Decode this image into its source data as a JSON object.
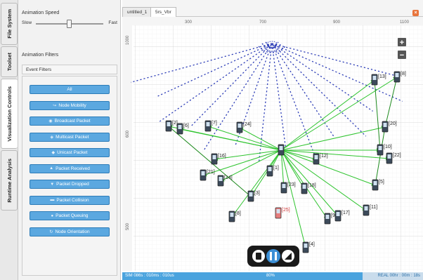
{
  "vertical_tabs": [
    {
      "label": "File System"
    },
    {
      "label": "Toolset"
    },
    {
      "label": "Visualization Controls"
    },
    {
      "label": "Runtime Analysis"
    }
  ],
  "panel": {
    "speed_title": "Animation Speed",
    "speed_slow": "Slow",
    "speed_fast": "Fast",
    "speed_level": 0.49,
    "filters_title": "Animation Filters",
    "event_filters": "Event Filters",
    "buttons": [
      {
        "label": "All",
        "icon": ""
      },
      {
        "label": "Node Mobility",
        "icon": "mobility-icon"
      },
      {
        "label": "Broadcast Packet",
        "icon": "broadcast-icon"
      },
      {
        "label": "Multicast Packet",
        "icon": "multicast-icon"
      },
      {
        "label": "Unicast Packet",
        "icon": "unicast-icon"
      },
      {
        "label": "Packet Received",
        "icon": "received-icon"
      },
      {
        "label": "Packet Dropped",
        "icon": "dropped-icon"
      },
      {
        "label": "Packet Collision",
        "icon": "collision-icon"
      },
      {
        "label": "Packet Queuing",
        "icon": "queuing-icon"
      },
      {
        "label": "Node Orientation",
        "icon": "orientation-icon"
      }
    ]
  },
  "tabs": [
    {
      "label": "untitled_1",
      "active": false
    },
    {
      "label": "5rs_Vbr",
      "active": true
    }
  ],
  "ruler": {
    "top": [
      "300",
      "700",
      "900",
      "1100"
    ],
    "left": [
      "1000",
      "600",
      "500"
    ]
  },
  "sink": {
    "label": ""
  },
  "hub": {
    "label": ""
  },
  "nodes": [
    {
      "label": "[1]"
    },
    {
      "label": "[2]"
    },
    {
      "label": "[3]"
    },
    {
      "label": "[4]"
    },
    {
      "label": "[5]"
    },
    {
      "label": "[6]"
    },
    {
      "label": "[7]"
    },
    {
      "label": "[8]"
    },
    {
      "label": "[9]"
    },
    {
      "label": "[10]"
    },
    {
      "label": "[11]"
    },
    {
      "label": "[12]"
    },
    {
      "label": "[13]"
    },
    {
      "label": "[14]"
    },
    {
      "label": "[16]"
    },
    {
      "label": "[17]"
    },
    {
      "label": "[18]"
    },
    {
      "label": "[20]"
    },
    {
      "label": "[21]"
    },
    {
      "label": "[22]"
    },
    {
      "label": "[23]"
    },
    {
      "label": "[24]"
    },
    {
      "label": "[25]"
    },
    {
      "label": "[8]"
    }
  ],
  "playback": {
    "stop": "stop",
    "pause": "pause",
    "speed": "speed"
  },
  "status": {
    "sim_time": "SIM 086s : 010ms : 010us",
    "percent": "80%",
    "real_time": "REAL 00hr : 00m : 18s",
    "progress": 0.8
  },
  "colors": {
    "accent": "#5ba8e0",
    "grid": "#e6e6e6",
    "wave": "#3040b8",
    "link": "#2ec42e",
    "dropped_node": "#e57c7c"
  }
}
